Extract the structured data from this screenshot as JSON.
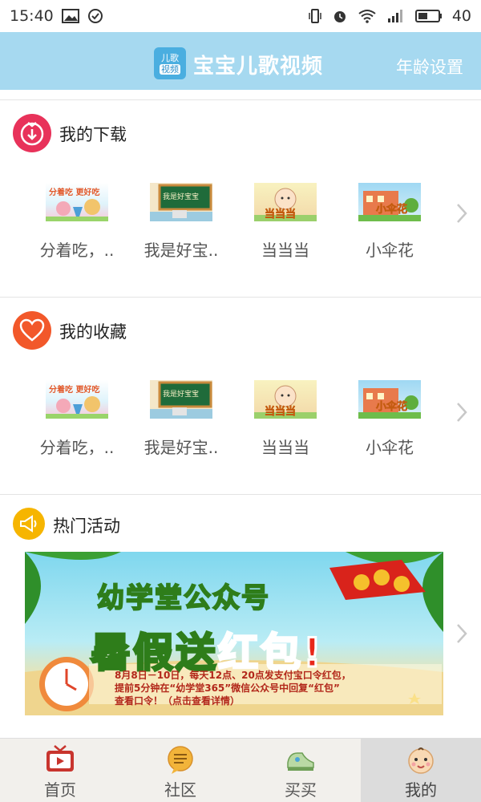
{
  "status_bar": {
    "time": "15:40",
    "battery": "40"
  },
  "header": {
    "logo_line1": "儿歌",
    "logo_line2": "视频",
    "title": "宝宝儿歌视频",
    "age_setting": "年龄设置"
  },
  "downloads": {
    "title": "我的下载",
    "items": [
      {
        "label": "分着吃，..",
        "thumb_text": "分着吃 更好吃"
      },
      {
        "label": "我是好宝..",
        "thumb_text": "我是好宝宝"
      },
      {
        "label": "当当当",
        "thumb_text": "当当当"
      },
      {
        "label": "小伞花",
        "thumb_text": "小伞花"
      }
    ]
  },
  "favorites": {
    "title": "我的收藏",
    "items": [
      {
        "label": "分着吃，..",
        "thumb_text": "分着吃 更好吃"
      },
      {
        "label": "我是好宝..",
        "thumb_text": "我是好宝宝"
      },
      {
        "label": "当当当",
        "thumb_text": "当当当"
      },
      {
        "label": "小伞花",
        "thumb_text": "小伞花"
      }
    ]
  },
  "activities": {
    "title": "热门活动",
    "banner": {
      "line1": "幼学堂公众号",
      "line2_part1": "暑假送",
      "line2_part2": "红包!",
      "detail1": "8月8日－10日，每天12点、20点发支付宝口令红包，",
      "detail2": "提前5分钟在“幼学堂365”微信公众号中回复“红包”",
      "detail3": "查看口令！（点击查看详情）"
    }
  },
  "tabs": [
    {
      "label": "首页",
      "icon": "tv-icon"
    },
    {
      "label": "社区",
      "icon": "chat-bubble-icon"
    },
    {
      "label": "买买",
      "icon": "shoe-icon"
    },
    {
      "label": "我的",
      "icon": "baby-face-icon"
    }
  ],
  "colors": {
    "header_bg": "#a6d9f0",
    "download_icon": "#e8325a",
    "favorite_icon": "#f2582a",
    "activity_icon": "#f6b500"
  }
}
